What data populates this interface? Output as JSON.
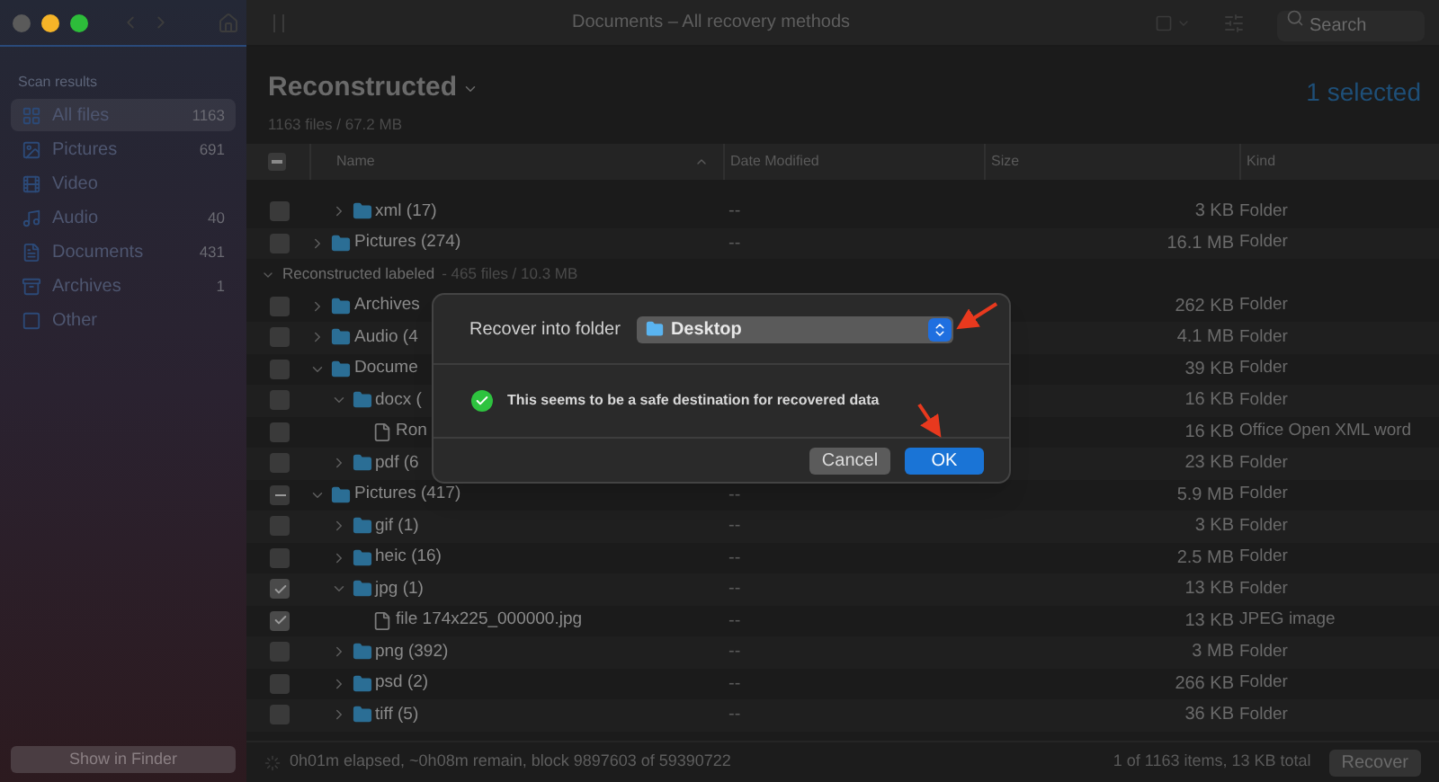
{
  "window": {
    "title": "Documents – All recovery methods",
    "search": {
      "placeholder": "Search"
    }
  },
  "sidebar": {
    "heading": "Scan results",
    "items": [
      {
        "label": "All files",
        "count": "1163",
        "selected": true,
        "kind": "all"
      },
      {
        "label": "Pictures",
        "count": "691",
        "selected": false,
        "kind": "pictures"
      },
      {
        "label": "Video",
        "selected": false,
        "kind": "video"
      },
      {
        "label": "Audio",
        "count": "40",
        "selected": false,
        "kind": "audio"
      },
      {
        "label": "Documents",
        "count": "431",
        "selected": false,
        "kind": "documents"
      },
      {
        "label": "Archives",
        "count": "1",
        "selected": false,
        "kind": "archives"
      },
      {
        "label": "Other",
        "selected": false,
        "kind": "other"
      }
    ],
    "button": "Show in Finder"
  },
  "header": {
    "title": "Reconstructed",
    "subtitle": "1163 files / 67.2 MB",
    "selection": "1 selected"
  },
  "table": {
    "select_all": {
      "mixed": true
    },
    "columns": [
      {
        "label": "Name",
        "sorted": true
      },
      {
        "label": "Date Modified",
        "sorted": false
      },
      {
        "label": "Size",
        "sorted": false
      },
      {
        "label": "Kind",
        "sorted": false
      }
    ],
    "groups": [
      {
        "items": [
          {
            "children": [
              {
                "kind": "folder",
                "name": "xml (17)",
                "date": "--",
                "size": "3 KB",
                "type": "Folder",
                "checked": false,
                "mixed": false,
                "expanded": false
              }
            ]
          },
          {
            "kind": "folder",
            "name": "Pictures (274)",
            "date": "--",
            "size": "16.1 MB",
            "type": "Folder",
            "checked": false,
            "mixed": false,
            "expanded": false
          }
        ]
      },
      {
        "title": "Reconstructed labeled",
        "summary": "- 465 files / 10.3 MB",
        "expanded": true,
        "items": [
          {
            "kind": "folder",
            "name": "Archives",
            "size": "262 KB",
            "type": "Folder",
            "checked": false,
            "mixed": false,
            "expanded": false
          },
          {
            "kind": "folder",
            "name": "Audio (4",
            "size": "4.1 MB",
            "type": "Folder",
            "checked": false,
            "mixed": false,
            "expanded": false
          },
          {
            "kind": "folder",
            "name": "Docume",
            "size": "39 KB",
            "type": "Folder",
            "checked": false,
            "mixed": false,
            "expanded": true,
            "children": [
              {
                "kind": "folder",
                "name": "docx (",
                "size": "16 KB",
                "type": "Folder",
                "checked": false,
                "mixed": false,
                "expanded": true,
                "children": [
                  {
                    "kind": "file",
                    "name": "Ron",
                    "size": "16 KB",
                    "type": "Office Open XML word",
                    "checked": false,
                    "mixed": false
                  }
                ]
              },
              {
                "kind": "folder",
                "name": "pdf (6",
                "size": "23 KB",
                "type": "Folder",
                "checked": false,
                "mixed": false,
                "expanded": false
              }
            ]
          },
          {
            "kind": "folder",
            "name": "Pictures (417)",
            "date": "--",
            "size": "5.9 MB",
            "type": "Folder",
            "checked": false,
            "mixed": true,
            "expanded": true,
            "children": [
              {
                "kind": "folder",
                "name": "gif (1)",
                "date": "--",
                "size": "3 KB",
                "type": "Folder",
                "checked": false,
                "mixed": false,
                "expanded": false
              },
              {
                "kind": "folder",
                "name": "heic (16)",
                "date": "--",
                "size": "2.5 MB",
                "type": "Folder",
                "checked": false,
                "mixed": false,
                "expanded": false
              },
              {
                "kind": "folder",
                "name": "jpg (1)",
                "date": "--",
                "size": "13 KB",
                "type": "Folder",
                "checked": true,
                "mixed": false,
                "expanded": true,
                "children": [
                  {
                    "kind": "file",
                    "name": "file 174x225_000000.jpg",
                    "date": "--",
                    "size": "13 KB",
                    "type": "JPEG image",
                    "checked": true,
                    "mixed": false
                  }
                ]
              },
              {
                "kind": "folder",
                "name": "png (392)",
                "date": "--",
                "size": "3 MB",
                "type": "Folder",
                "checked": false,
                "mixed": false,
                "expanded": false
              },
              {
                "kind": "folder",
                "name": "psd (2)",
                "date": "--",
                "size": "266 KB",
                "type": "Folder",
                "checked": false,
                "mixed": false,
                "expanded": false
              },
              {
                "kind": "folder",
                "name": "tiff (5)",
                "date": "--",
                "size": "36 KB",
                "type": "Folder",
                "checked": false,
                "mixed": false,
                "expanded": false
              }
            ]
          }
        ]
      }
    ]
  },
  "status_bar": {
    "progress": "0h01m elapsed, ~0h08m remain, block 9897603 of 59390722",
    "summary": "1 of 1163 items, 13 KB total",
    "button": "Recover"
  },
  "dialog": {
    "label": "Recover into folder",
    "folder": "Desktop",
    "message": "This seems to be a safe destination for recovered data",
    "buttons": [
      {
        "label": "Cancel",
        "kind": "secondary"
      },
      {
        "label": "OK",
        "kind": "primary"
      }
    ]
  }
}
